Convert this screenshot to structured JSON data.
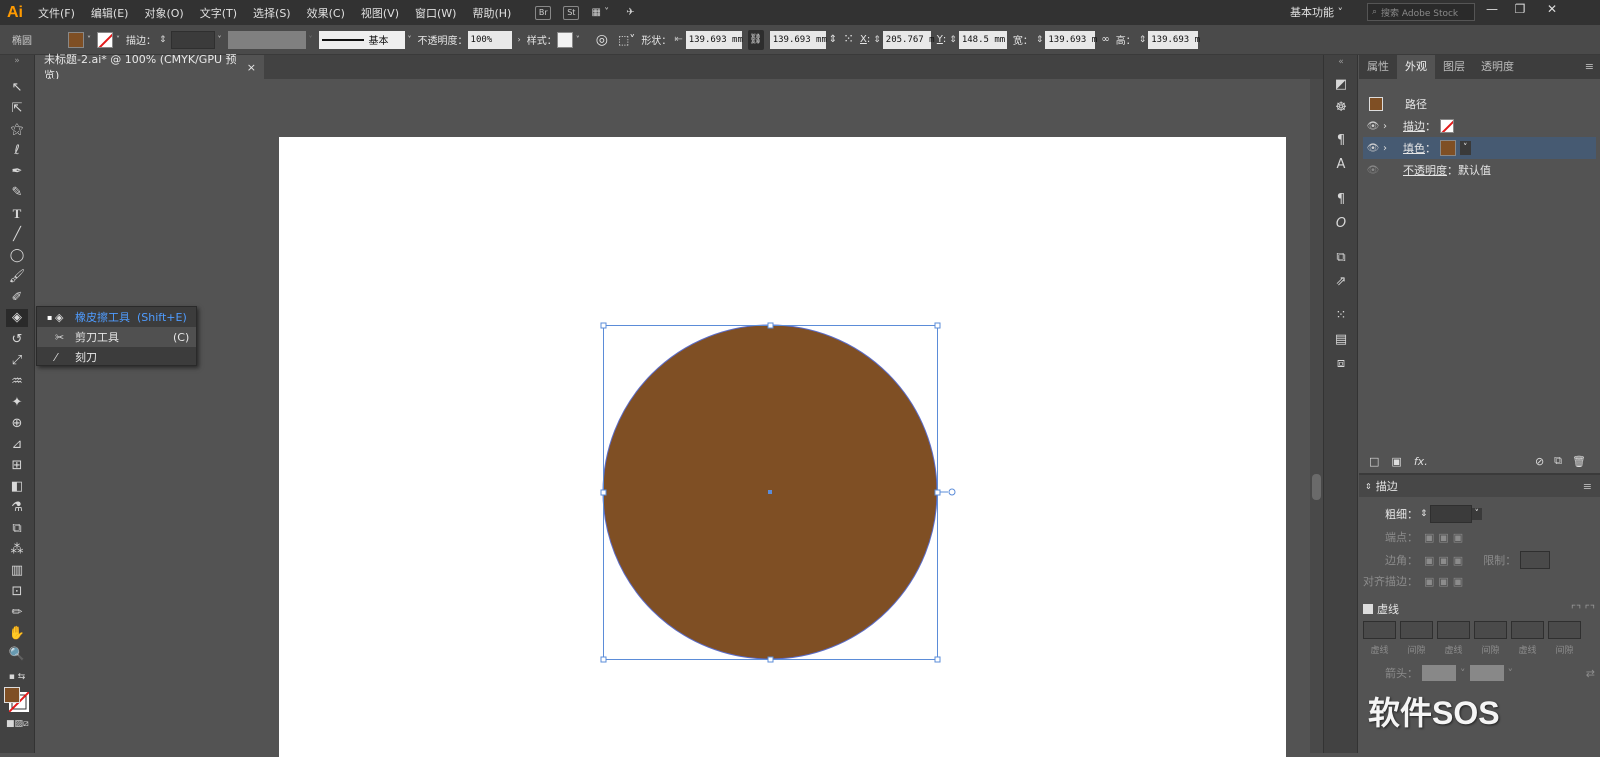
{
  "app": {
    "logo": "Ai",
    "workspace": "基本功能",
    "search_placeholder": "搜索 Adobe Stock"
  },
  "menu": [
    "文件(F)",
    "编辑(E)",
    "对象(O)",
    "文字(T)",
    "选择(S)",
    "效果(C)",
    "视图(V)",
    "窗口(W)",
    "帮助(H)"
  ],
  "menu_icons": {
    "bridge": "Br",
    "stock": "St"
  },
  "control": {
    "object_type": "椭圆",
    "fill_color": "#7f4f24",
    "stroke_label": "描边",
    "stroke_style": "基本",
    "opacity_label": "不透明度",
    "opacity_value": "100%",
    "style_label": "样式",
    "shape_label": "形状",
    "width1": "139.693 mm",
    "width2": "139.693 mm",
    "x_label": "X",
    "x_value": "205.767 m",
    "y_label": "Y",
    "y_value": "148.5 mm",
    "w_label": "宽",
    "w_value": "139.693 m",
    "h_label": "高",
    "h_value": "139.693 m"
  },
  "document": {
    "tab_title": "未标题-2.ai* @ 100% (CMYK/GPU 预览)",
    "close": "×"
  },
  "flyout": {
    "items": [
      {
        "label": "橡皮擦工具",
        "shortcut": "(Shift+E)",
        "active": true
      },
      {
        "label": "剪刀工具",
        "shortcut": "(C)",
        "active": false
      },
      {
        "label": "刻刀",
        "shortcut": "",
        "active": false
      }
    ]
  },
  "appearance_panel": {
    "tabs": [
      "属性",
      "外观",
      "图层",
      "透明度"
    ],
    "active_tab": "外观",
    "object": "路径",
    "stroke_label": "描边",
    "fill_label": "填色",
    "opacity_label": "不透明度",
    "opacity_value": "默认值",
    "fx": "fx."
  },
  "stroke_panel": {
    "title": "描边",
    "weight_label": "粗细",
    "cap_label": "端点",
    "corner_label": "边角",
    "limit_label": "限制",
    "align_label": "对齐描边",
    "dashed_label": "虚线",
    "dash_labels": [
      "虚线",
      "间隙",
      "虚线",
      "间隙",
      "虚线",
      "间隙"
    ],
    "arrow_label": "箭头"
  },
  "watermark": "软件SOS",
  "colors": {
    "accent": "#5b8cd8",
    "fill": "#7f4f24",
    "selected_row": "#465a72",
    "canvas": "#535353"
  }
}
